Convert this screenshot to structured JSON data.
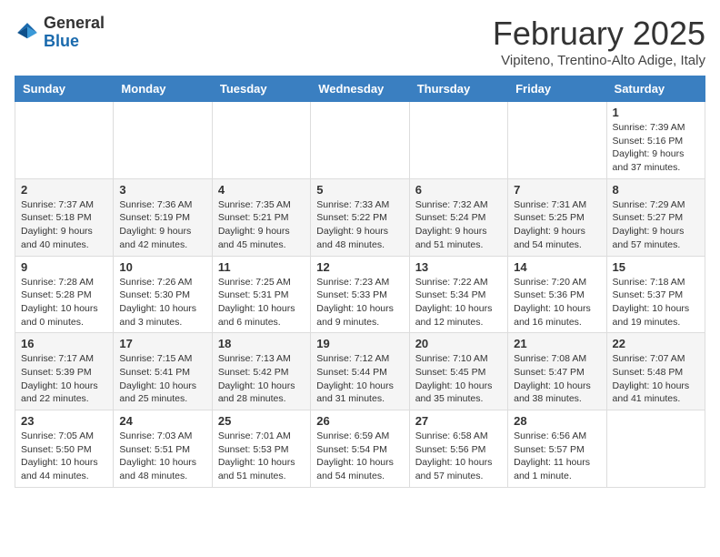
{
  "header": {
    "logo_general": "General",
    "logo_blue": "Blue",
    "month_title": "February 2025",
    "location": "Vipiteno, Trentino-Alto Adige, Italy"
  },
  "days_of_week": [
    "Sunday",
    "Monday",
    "Tuesday",
    "Wednesday",
    "Thursday",
    "Friday",
    "Saturday"
  ],
  "weeks": [
    [
      {
        "day": "",
        "info": ""
      },
      {
        "day": "",
        "info": ""
      },
      {
        "day": "",
        "info": ""
      },
      {
        "day": "",
        "info": ""
      },
      {
        "day": "",
        "info": ""
      },
      {
        "day": "",
        "info": ""
      },
      {
        "day": "1",
        "info": "Sunrise: 7:39 AM\nSunset: 5:16 PM\nDaylight: 9 hours and 37 minutes."
      }
    ],
    [
      {
        "day": "2",
        "info": "Sunrise: 7:37 AM\nSunset: 5:18 PM\nDaylight: 9 hours and 40 minutes."
      },
      {
        "day": "3",
        "info": "Sunrise: 7:36 AM\nSunset: 5:19 PM\nDaylight: 9 hours and 42 minutes."
      },
      {
        "day": "4",
        "info": "Sunrise: 7:35 AM\nSunset: 5:21 PM\nDaylight: 9 hours and 45 minutes."
      },
      {
        "day": "5",
        "info": "Sunrise: 7:33 AM\nSunset: 5:22 PM\nDaylight: 9 hours and 48 minutes."
      },
      {
        "day": "6",
        "info": "Sunrise: 7:32 AM\nSunset: 5:24 PM\nDaylight: 9 hours and 51 minutes."
      },
      {
        "day": "7",
        "info": "Sunrise: 7:31 AM\nSunset: 5:25 PM\nDaylight: 9 hours and 54 minutes."
      },
      {
        "day": "8",
        "info": "Sunrise: 7:29 AM\nSunset: 5:27 PM\nDaylight: 9 hours and 57 minutes."
      }
    ],
    [
      {
        "day": "9",
        "info": "Sunrise: 7:28 AM\nSunset: 5:28 PM\nDaylight: 10 hours and 0 minutes."
      },
      {
        "day": "10",
        "info": "Sunrise: 7:26 AM\nSunset: 5:30 PM\nDaylight: 10 hours and 3 minutes."
      },
      {
        "day": "11",
        "info": "Sunrise: 7:25 AM\nSunset: 5:31 PM\nDaylight: 10 hours and 6 minutes."
      },
      {
        "day": "12",
        "info": "Sunrise: 7:23 AM\nSunset: 5:33 PM\nDaylight: 10 hours and 9 minutes."
      },
      {
        "day": "13",
        "info": "Sunrise: 7:22 AM\nSunset: 5:34 PM\nDaylight: 10 hours and 12 minutes."
      },
      {
        "day": "14",
        "info": "Sunrise: 7:20 AM\nSunset: 5:36 PM\nDaylight: 10 hours and 16 minutes."
      },
      {
        "day": "15",
        "info": "Sunrise: 7:18 AM\nSunset: 5:37 PM\nDaylight: 10 hours and 19 minutes."
      }
    ],
    [
      {
        "day": "16",
        "info": "Sunrise: 7:17 AM\nSunset: 5:39 PM\nDaylight: 10 hours and 22 minutes."
      },
      {
        "day": "17",
        "info": "Sunrise: 7:15 AM\nSunset: 5:41 PM\nDaylight: 10 hours and 25 minutes."
      },
      {
        "day": "18",
        "info": "Sunrise: 7:13 AM\nSunset: 5:42 PM\nDaylight: 10 hours and 28 minutes."
      },
      {
        "day": "19",
        "info": "Sunrise: 7:12 AM\nSunset: 5:44 PM\nDaylight: 10 hours and 31 minutes."
      },
      {
        "day": "20",
        "info": "Sunrise: 7:10 AM\nSunset: 5:45 PM\nDaylight: 10 hours and 35 minutes."
      },
      {
        "day": "21",
        "info": "Sunrise: 7:08 AM\nSunset: 5:47 PM\nDaylight: 10 hours and 38 minutes."
      },
      {
        "day": "22",
        "info": "Sunrise: 7:07 AM\nSunset: 5:48 PM\nDaylight: 10 hours and 41 minutes."
      }
    ],
    [
      {
        "day": "23",
        "info": "Sunrise: 7:05 AM\nSunset: 5:50 PM\nDaylight: 10 hours and 44 minutes."
      },
      {
        "day": "24",
        "info": "Sunrise: 7:03 AM\nSunset: 5:51 PM\nDaylight: 10 hours and 48 minutes."
      },
      {
        "day": "25",
        "info": "Sunrise: 7:01 AM\nSunset: 5:53 PM\nDaylight: 10 hours and 51 minutes."
      },
      {
        "day": "26",
        "info": "Sunrise: 6:59 AM\nSunset: 5:54 PM\nDaylight: 10 hours and 54 minutes."
      },
      {
        "day": "27",
        "info": "Sunrise: 6:58 AM\nSunset: 5:56 PM\nDaylight: 10 hours and 57 minutes."
      },
      {
        "day": "28",
        "info": "Sunrise: 6:56 AM\nSunset: 5:57 PM\nDaylight: 11 hours and 1 minute."
      },
      {
        "day": "",
        "info": ""
      }
    ]
  ]
}
